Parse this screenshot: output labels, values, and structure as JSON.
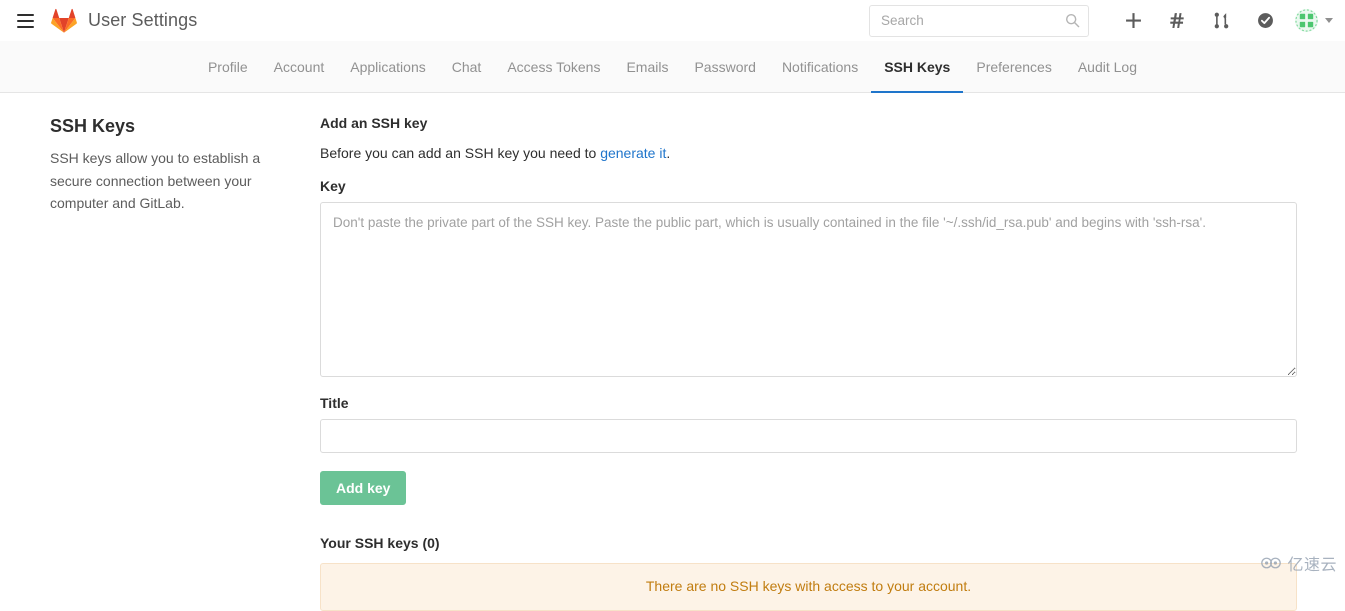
{
  "header": {
    "menu_icon": "hamburger-icon",
    "logo_icon": "gitlab-logo-icon",
    "title": "User Settings",
    "search": {
      "placeholder": "Search",
      "value": "",
      "icon": "search-icon"
    },
    "actions": [
      {
        "name": "new-item-button",
        "icon": "plus-icon",
        "label": "+"
      },
      {
        "name": "issues-button",
        "icon": "hash-icon",
        "label": "#"
      },
      {
        "name": "merge-requests-button",
        "icon": "merge-request-icon",
        "label": ""
      },
      {
        "name": "todos-button",
        "icon": "check-circle-icon",
        "label": ""
      }
    ],
    "avatar": {
      "name": "user-avatar",
      "icon": "avatar-identicon",
      "color": "#4cc66f"
    },
    "caret_icon": "chevron-down-icon"
  },
  "subnav": {
    "tabs": [
      {
        "label": "Profile",
        "active": false
      },
      {
        "label": "Account",
        "active": false
      },
      {
        "label": "Applications",
        "active": false
      },
      {
        "label": "Chat",
        "active": false
      },
      {
        "label": "Access Tokens",
        "active": false
      },
      {
        "label": "Emails",
        "active": false
      },
      {
        "label": "Password",
        "active": false
      },
      {
        "label": "Notifications",
        "active": false
      },
      {
        "label": "SSH Keys",
        "active": true
      },
      {
        "label": "Preferences",
        "active": false
      },
      {
        "label": "Audit Log",
        "active": false
      }
    ],
    "active_color": "#1f75cb"
  },
  "sidebar": {
    "title": "SSH Keys",
    "description": "SSH keys allow you to establish a secure connection between your computer and GitLab."
  },
  "main": {
    "section_title": "Add an SSH key",
    "intro_prefix": "Before you can add an SSH key you need to ",
    "intro_link": "generate it",
    "intro_suffix": ".",
    "key_label": "Key",
    "key_placeholder": "Don't paste the private part of the SSH key. Paste the public part, which is usually contained in the file '~/.ssh/id_rsa.pub' and begins with 'ssh-rsa'.",
    "key_value": "",
    "title_label": "Title",
    "title_placeholder": "",
    "title_value": "",
    "submit_label": "Add key",
    "submit_color": "#6bc396",
    "keys_header": "Your SSH keys (0)",
    "empty_message": "There are no SSH keys with access to your account.",
    "empty_color": "#c17d10"
  },
  "watermark": {
    "text": "亿速云",
    "icon": "cloud-logo-icon"
  }
}
